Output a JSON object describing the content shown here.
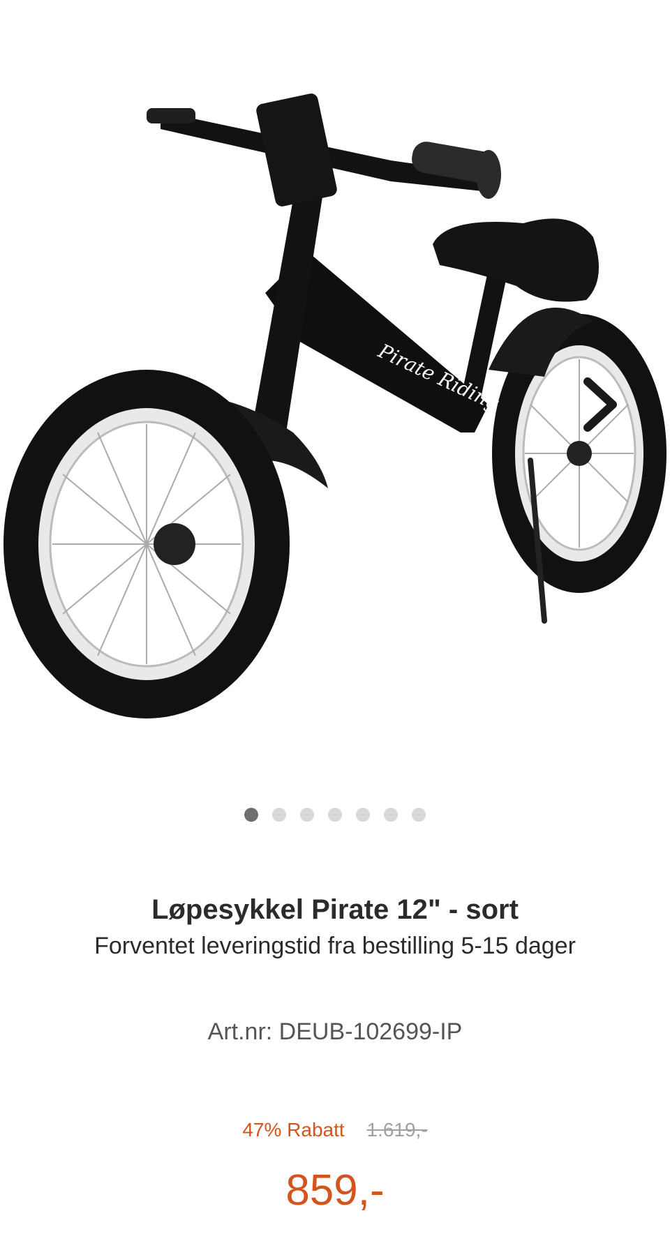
{
  "gallery": {
    "image_alt": "Løpesykkel Pirate 12\" - sort",
    "decal_text": "Pirate Riding",
    "next_icon": "chevron-right-icon",
    "dots_count": 7,
    "active_dot": 1
  },
  "product": {
    "title": "Løpesykkel Pirate 12\" - sort",
    "delivery": "Forventet leveringstid fra bestilling 5-15 dager",
    "artnr": "Art.nr: DEUB-102699-IP",
    "discount": "47% Rabatt",
    "old_price": "1.619,-",
    "price": "859,-"
  },
  "colors": {
    "accent": "#d4541e",
    "dot_active": "#6f6f6f",
    "dot_inactive": "#d9d9d9"
  }
}
